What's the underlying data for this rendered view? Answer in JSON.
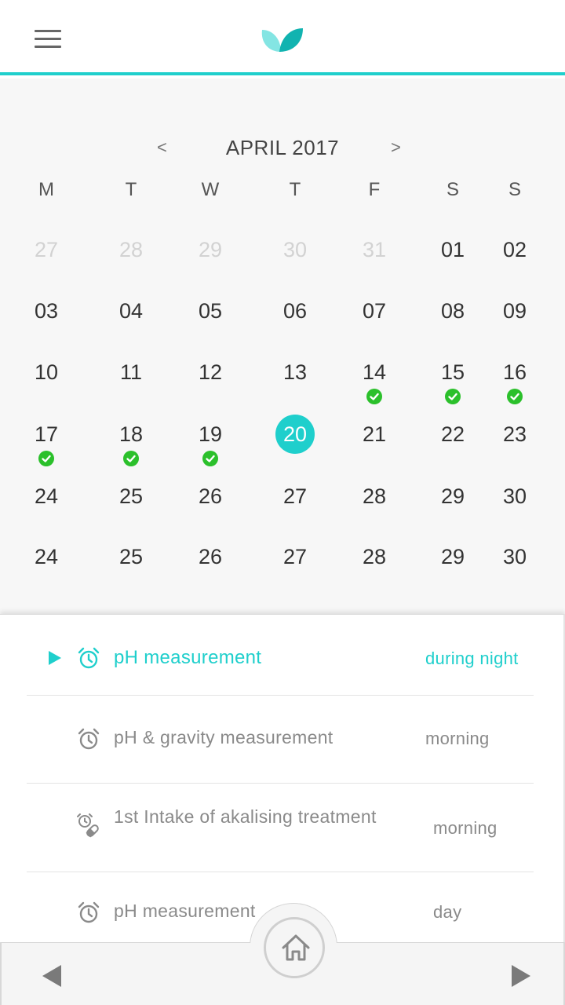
{
  "header": {
    "menu_icon": "hamburger-menu-icon",
    "logo_icon": "leaf-logo-icon",
    "accent_color": "#1fcfcc"
  },
  "calendar": {
    "month_title": "APRIL 2017",
    "prev_symbol": "<",
    "next_symbol": ">",
    "weekdays": [
      "M",
      "T",
      "W",
      "T",
      "F",
      "S",
      "S"
    ],
    "weeks": [
      [
        {
          "n": "27",
          "other": true
        },
        {
          "n": "28",
          "other": true
        },
        {
          "n": "29",
          "other": true
        },
        {
          "n": "30",
          "other": true
        },
        {
          "n": "31",
          "other": true
        },
        {
          "n": "01"
        },
        {
          "n": "02"
        }
      ],
      [
        {
          "n": "03"
        },
        {
          "n": "04"
        },
        {
          "n": "05"
        },
        {
          "n": "06"
        },
        {
          "n": "07"
        },
        {
          "n": "08"
        },
        {
          "n": "09"
        }
      ],
      [
        {
          "n": "10"
        },
        {
          "n": "11"
        },
        {
          "n": "12"
        },
        {
          "n": "13"
        },
        {
          "n": "14",
          "done": true
        },
        {
          "n": "15",
          "done": true
        },
        {
          "n": "16",
          "done": true
        }
      ],
      [
        {
          "n": "17",
          "done": true
        },
        {
          "n": "18",
          "done": true
        },
        {
          "n": "19",
          "done": true
        },
        {
          "n": "20",
          "selected": true
        },
        {
          "n": "21"
        },
        {
          "n": "22"
        },
        {
          "n": "23"
        }
      ],
      [
        {
          "n": "24"
        },
        {
          "n": "25"
        },
        {
          "n": "26"
        },
        {
          "n": "27"
        },
        {
          "n": "28"
        },
        {
          "n": "29"
        },
        {
          "n": "30"
        }
      ],
      [
        {
          "n": "24"
        },
        {
          "n": "25"
        },
        {
          "n": "26"
        },
        {
          "n": "27"
        },
        {
          "n": "28"
        },
        {
          "n": "29"
        },
        {
          "n": "30"
        }
      ]
    ],
    "selected_color": "#1fcfcc",
    "done_color": "#2bc02b"
  },
  "tasks": [
    {
      "title": "pH measurement",
      "when": "during night",
      "icon": "alarm-clock-icon",
      "active": true
    },
    {
      "title": "pH & gravity measurement",
      "when": "morning",
      "icon": "alarm-clock-icon",
      "active": false
    },
    {
      "title": "1st Intake of akalising treatment",
      "when": "morning",
      "icon": "alarm-pill-icon",
      "active": false
    },
    {
      "title": "pH measurement",
      "when": "day",
      "icon": "alarm-clock-icon",
      "active": false
    }
  ],
  "footer": {
    "prev_icon": "triangle-left-icon",
    "home_icon": "home-icon",
    "next_icon": "triangle-right-icon"
  }
}
